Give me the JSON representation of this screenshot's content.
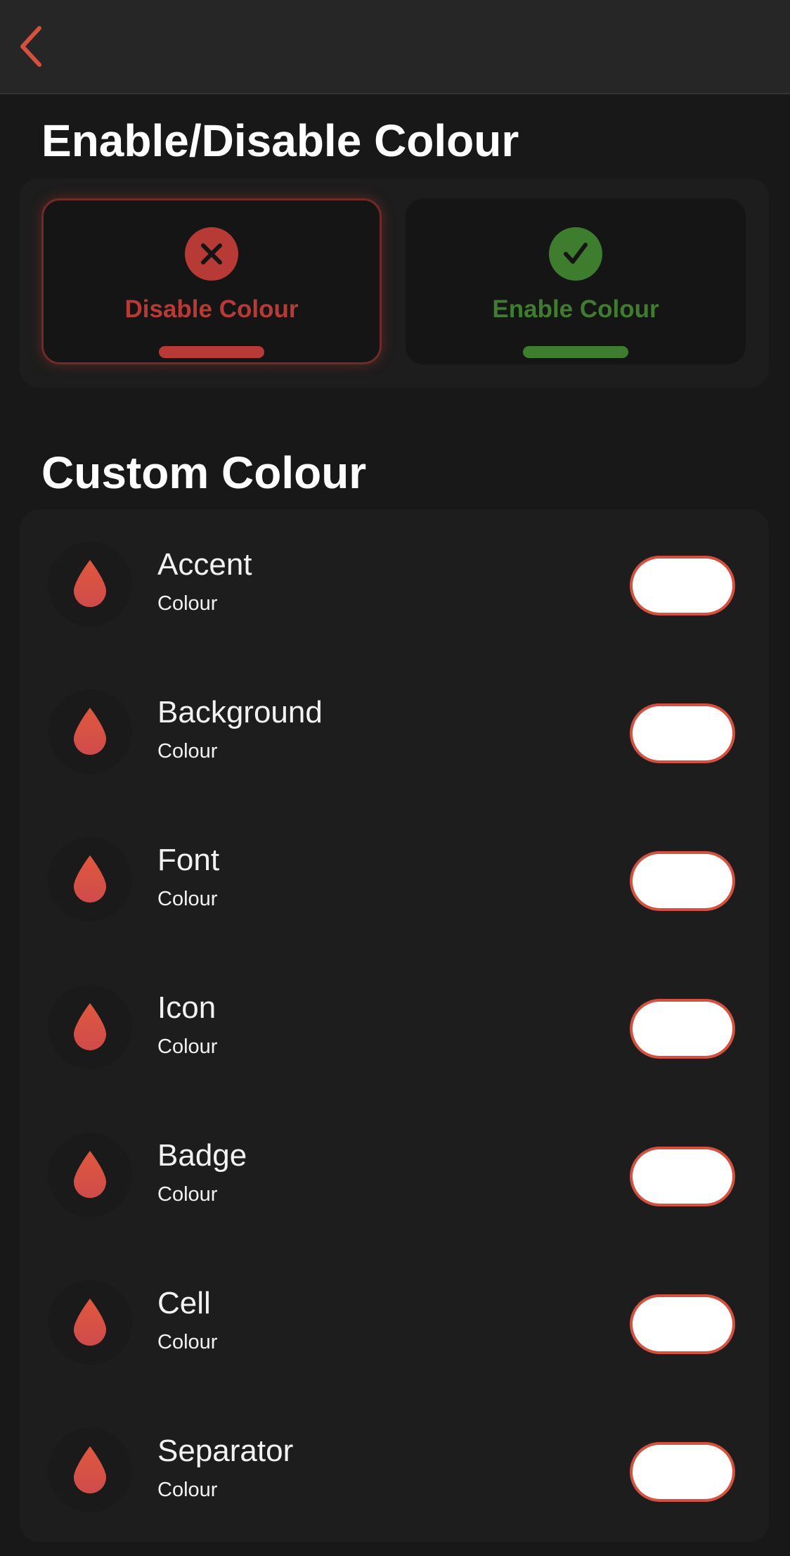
{
  "nav": {
    "back_icon": "chevron-left-icon"
  },
  "colors": {
    "accent": "#d6503f",
    "disable": "#b83a37",
    "enable": "#3f7d2e",
    "swatch_fill": "#ffffff"
  },
  "toggle_section": {
    "title": "Enable/Disable Colour",
    "disable": {
      "label": "Disable Colour",
      "icon": "close-circle-icon",
      "selected": true
    },
    "enable": {
      "label": "Enable Colour",
      "icon": "check-circle-icon",
      "selected": false
    }
  },
  "custom_section": {
    "title": "Custom Colour",
    "items": [
      {
        "title": "Accent",
        "subtitle": "Colour",
        "icon": "drop-icon"
      },
      {
        "title": "Background",
        "subtitle": "Colour",
        "icon": "drop-icon"
      },
      {
        "title": "Font",
        "subtitle": "Colour",
        "icon": "drop-icon"
      },
      {
        "title": "Icon",
        "subtitle": "Colour",
        "icon": "drop-icon"
      },
      {
        "title": "Badge",
        "subtitle": "Colour",
        "icon": "drop-icon"
      },
      {
        "title": "Cell",
        "subtitle": "Colour",
        "icon": "drop-icon"
      },
      {
        "title": "Separator",
        "subtitle": "Colour",
        "icon": "drop-icon"
      }
    ]
  }
}
